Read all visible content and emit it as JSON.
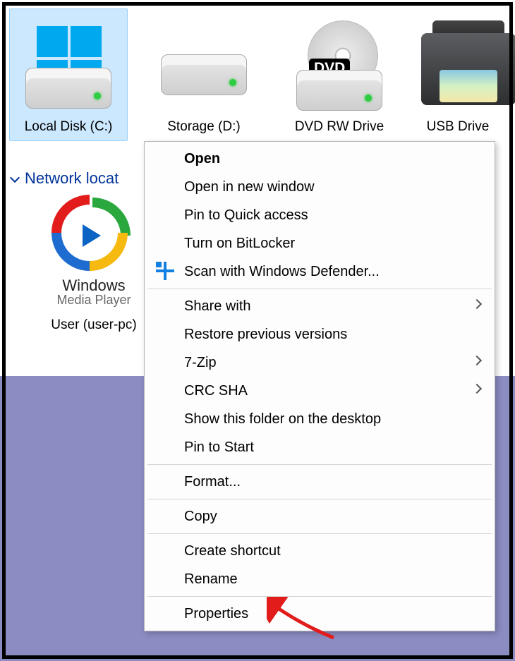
{
  "drives": [
    {
      "label": "Local Disk (C:)"
    },
    {
      "label": "Storage (D:)"
    },
    {
      "label": "DVD RW Drive"
    },
    {
      "label": "USB Drive"
    }
  ],
  "dvd_badge": "DVD",
  "network": {
    "header": "Network locat",
    "item": {
      "line1": "Windows",
      "line2": "Media Player",
      "label": "User (user-pc)"
    }
  },
  "menu": {
    "open": "Open",
    "open_new": "Open in new window",
    "pin_quick": "Pin to Quick access",
    "bitlocker": "Turn on BitLocker",
    "defender": "Scan with Windows Defender...",
    "share": "Share with",
    "restore": "Restore previous versions",
    "sevenzip": "7-Zip",
    "crc": "CRC SHA",
    "show_desktop": "Show this folder on the desktop",
    "pin_start": "Pin to Start",
    "format": "Format...",
    "copy": "Copy",
    "shortcut": "Create shortcut",
    "rename": "Rename",
    "properties": "Properties"
  }
}
